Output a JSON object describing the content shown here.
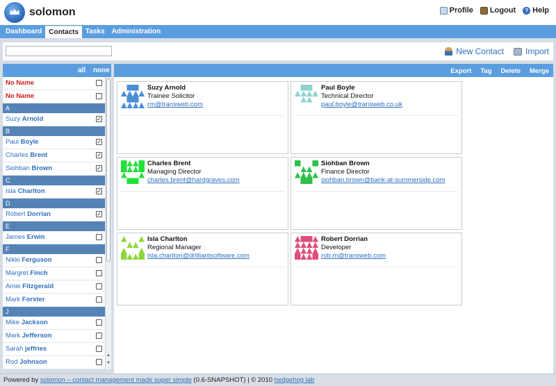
{
  "app": {
    "title": "solomon"
  },
  "top_links": [
    {
      "label": "Profile",
      "icon": "profile-icon"
    },
    {
      "label": "Logout",
      "icon": "logout-icon"
    },
    {
      "label": "Help",
      "icon": "help-icon"
    }
  ],
  "nav": {
    "tabs": [
      "Dashboard",
      "Contacts",
      "Tasks",
      "Administration"
    ],
    "active": "Contacts"
  },
  "toolbar": {
    "search_value": "",
    "new_contact": "New Contact",
    "import": "Import"
  },
  "list_header": {
    "all": "all",
    "none": "none"
  },
  "list": [
    {
      "kind": "noname",
      "text": "No Name",
      "checked": false
    },
    {
      "kind": "noname",
      "text": "No Name",
      "checked": false
    },
    {
      "kind": "letter",
      "text": "A"
    },
    {
      "kind": "contact",
      "first": "Suzy",
      "last": "Arnold",
      "checked": true
    },
    {
      "kind": "letter",
      "text": "B"
    },
    {
      "kind": "contact",
      "first": "Paul",
      "last": "Boyle",
      "checked": true
    },
    {
      "kind": "contact",
      "first": "Charles",
      "last": "Brent",
      "checked": true
    },
    {
      "kind": "contact",
      "first": "Siohban",
      "last": "Brown",
      "checked": true
    },
    {
      "kind": "letter",
      "text": "C"
    },
    {
      "kind": "contact",
      "first": "Isla",
      "last": "Charlton",
      "checked": true
    },
    {
      "kind": "letter",
      "text": "D"
    },
    {
      "kind": "contact",
      "first": "Robert",
      "last": "Dorrian",
      "checked": true
    },
    {
      "kind": "letter",
      "text": "E"
    },
    {
      "kind": "contact",
      "first": "James",
      "last": "Erwin",
      "checked": false
    },
    {
      "kind": "letter",
      "text": "F"
    },
    {
      "kind": "contact",
      "first": "Nikki",
      "last": "Ferguson",
      "checked": false
    },
    {
      "kind": "contact",
      "first": "Margret",
      "last": "Finch",
      "checked": false
    },
    {
      "kind": "contact",
      "first": "Amie",
      "last": "Fitzgerald",
      "checked": false
    },
    {
      "kind": "contact",
      "first": "Mark",
      "last": "Forster",
      "checked": false
    },
    {
      "kind": "letter",
      "text": "J"
    },
    {
      "kind": "contact",
      "first": "Mike",
      "last": "Jackson",
      "checked": false
    },
    {
      "kind": "contact",
      "first": "Mark",
      "last": "Jefferson",
      "checked": false
    },
    {
      "kind": "contact",
      "first": "Sarah",
      "last": "jeffries",
      "checked": false
    },
    {
      "kind": "contact",
      "first": "Rod",
      "last": "Johnson",
      "checked": false
    }
  ],
  "right_actions": [
    "Export",
    "Tag",
    "Delete",
    "Merge"
  ],
  "cards": [
    {
      "name": "Suzy Arnold",
      "title": "Trainee Solicitor",
      "email": "rm@transweb.com",
      "color": "#4a8fd6"
    },
    {
      "name": "Paul Boyle",
      "title": "Technical Director",
      "email": "paul.boyle@transweb.co.uk",
      "color": "#8fd3cf"
    },
    {
      "name": "Charles Brent",
      "title": "Managing Director",
      "email": "charles.brent@hardgraves.com",
      "color": "#22e03a"
    },
    {
      "name": "Siohban Brown",
      "title": "Finance Director",
      "email": "siohban.brown@bank-at-summerside.com",
      "color": "#2fc04a"
    },
    {
      "name": "Isla Charlton",
      "title": "Regional Manager",
      "email": "isla.charlton@drilliantsoftware.com",
      "color": "#8fd63a"
    },
    {
      "name": "Robert Dorrian",
      "title": "Developer",
      "email": "rob.m@transweb.com",
      "color": "#e04e7a"
    }
  ],
  "footer": {
    "prefix": "Powered by",
    "link1": "solomon –  contact management made super simple",
    "version": "(0.6-SNAPSHOT)  |  © 2010",
    "link2": "hedgehog lab"
  }
}
